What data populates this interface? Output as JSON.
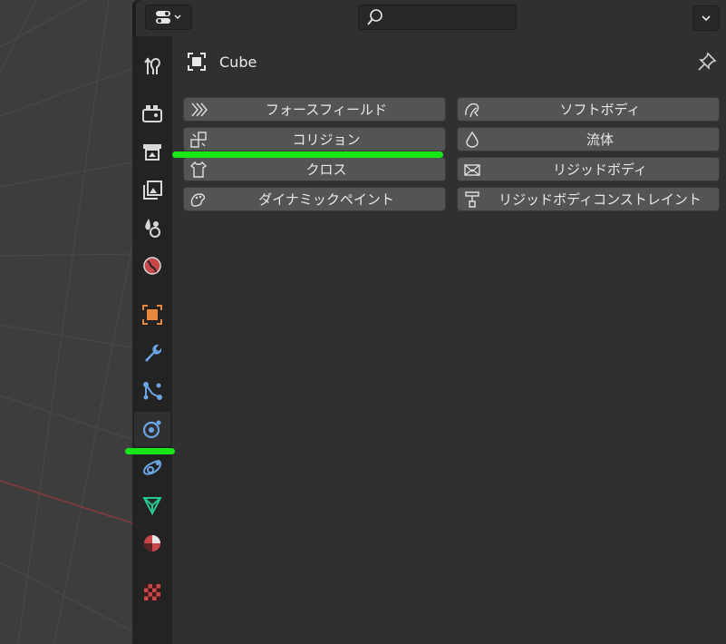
{
  "header": {
    "editor_type_icon": "properties-editor-icon",
    "search_placeholder": "",
    "menu_icon": "chevron-down-icon"
  },
  "tabs": [
    {
      "name": "tool",
      "icon": "tool-icon",
      "active": false
    },
    {
      "name": "render",
      "icon": "render-icon",
      "active": false
    },
    {
      "name": "output",
      "icon": "output-icon",
      "active": false
    },
    {
      "name": "view-layer",
      "icon": "view-layer-icon",
      "active": false
    },
    {
      "name": "scene",
      "icon": "scene-icon",
      "active": false
    },
    {
      "name": "world",
      "icon": "world-icon",
      "active": false
    },
    {
      "name": "object",
      "icon": "object-icon",
      "active": false
    },
    {
      "name": "modifiers",
      "icon": "wrench-icon",
      "active": false
    },
    {
      "name": "particles",
      "icon": "particles-icon",
      "active": false
    },
    {
      "name": "physics",
      "icon": "physics-icon",
      "active": true
    },
    {
      "name": "constraints",
      "icon": "constraints-icon",
      "active": false
    },
    {
      "name": "data",
      "icon": "mesh-data-icon",
      "active": false
    },
    {
      "name": "material",
      "icon": "material-icon",
      "active": false
    },
    {
      "name": "texture",
      "icon": "texture-icon",
      "active": false
    }
  ],
  "object": {
    "name": "Cube",
    "icon": "object-icon"
  },
  "physics_buttons": {
    "force_field": "フォースフィールド",
    "collision": "コリジョン",
    "cloth": "クロス",
    "dynamic_paint": "ダイナミックペイント",
    "soft_body": "ソフトボディ",
    "fluid": "流体",
    "rigid_body": "リジッドボディ",
    "rigid_body_constraint": "リジッドボディコンストレイント"
  },
  "colors": {
    "highlight": "#19e619",
    "panel_bg": "#303030",
    "button_bg": "#545454",
    "tab_bg": "#232323"
  }
}
